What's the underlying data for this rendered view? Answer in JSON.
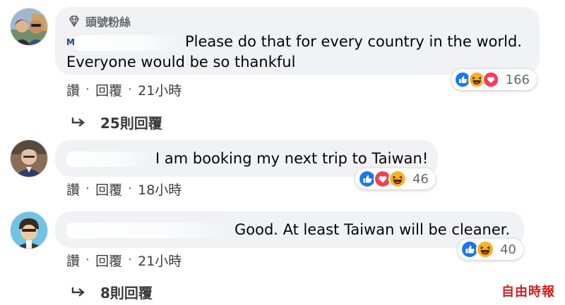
{
  "comments": [
    {
      "badge": "頭號粉絲",
      "author_visible": "M",
      "text_line1": "Please do that for every country in the world.",
      "text_line2": "Everyone would be so thankful",
      "like": "讚",
      "reply": "回覆",
      "time": "21小時",
      "reaction_count": "166",
      "replies_label": "25則回覆"
    },
    {
      "text": "I am booking my next trip to Taiwan!",
      "like": "讚",
      "reply": "回覆",
      "time": "18小時",
      "reaction_count": "46"
    },
    {
      "text": "Good. At least Taiwan will be cleaner.",
      "like": "讚",
      "reply": "回覆",
      "time": "21小時",
      "reaction_count": "40",
      "replies_label": "8則回覆"
    }
  ],
  "separator": "·",
  "watermark": "自由時報",
  "colors": {
    "like_blue": "#1877f2",
    "love_red": "#f33e58",
    "haha_yellow": "#f7b125",
    "bubble_bg": "#f0f2f5",
    "watermark_red": "#d41f1f"
  }
}
